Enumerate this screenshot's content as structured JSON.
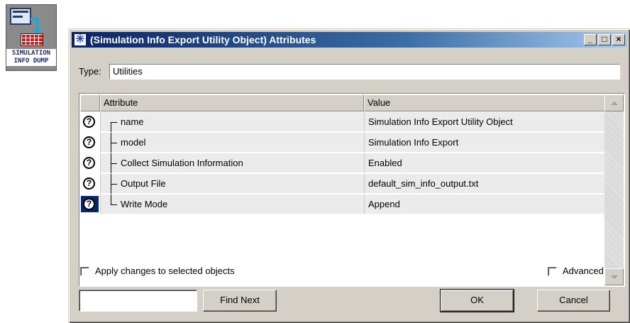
{
  "object_icon": {
    "label_line1": "SIMULATION",
    "label_line2": "INFO DUMP"
  },
  "window": {
    "title": "(Simulation Info Export Utility Object) Attributes",
    "title_icon": "asterisk-star-icon",
    "controls": {
      "minimize": "_",
      "maximize": "□",
      "close": "×"
    }
  },
  "type_field": {
    "label": "Type:",
    "value": "Utilities"
  },
  "table": {
    "headers": {
      "icon": "",
      "attribute": "Attribute",
      "value": "Value"
    },
    "rows": [
      {
        "help": "?",
        "name": "name",
        "value": "Simulation Info Export Utility Object"
      },
      {
        "help": "?",
        "name": "model",
        "value": "Simulation Info Export"
      },
      {
        "help": "?",
        "name": "Collect Simulation Information",
        "value": "Enabled"
      },
      {
        "help": "?",
        "name": "Output File",
        "value": "default_sim_info_output.txt"
      },
      {
        "help": "?",
        "name": "Write Mode",
        "value": "Append"
      }
    ]
  },
  "options": {
    "apply_changes": {
      "label": "Apply changes to selected objects",
      "checked": false
    },
    "advanced": {
      "label": "Advanced",
      "checked": false
    }
  },
  "buttons": {
    "find_next": "Find Next",
    "ok": "OK",
    "cancel": "Cancel"
  },
  "find_input": {
    "value": ""
  },
  "colors": {
    "title_start": "#0a246a",
    "title_end": "#a6caf0",
    "window_face": "#d4d0c8",
    "row_bg": "#ebebeb"
  }
}
